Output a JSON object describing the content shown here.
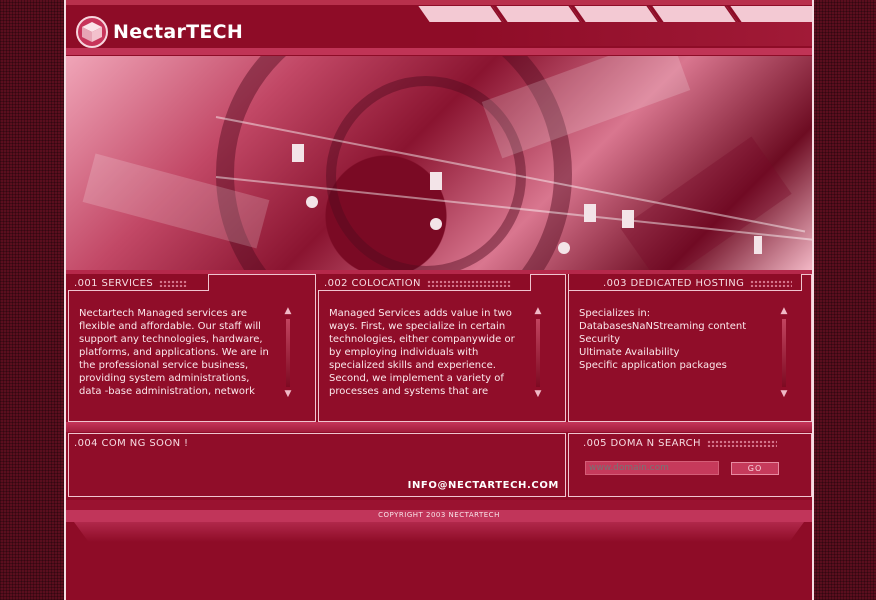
{
  "brand": {
    "name": "NectarTECH"
  },
  "colors": {
    "primary": "#8e0c27",
    "accent": "#c1355a",
    "light": "#f3c9d3",
    "text": "#fbe8ec"
  },
  "panels": [
    {
      "title": ".001 SERVICES",
      "text": "Nectartech Managed services are flexible and affordable. Our staff will support any technologies, hardware, platforms, and applications. We are in the professional service business, providing system administrations, data -base administration, network"
    },
    {
      "title": ".002 COLOCATION",
      "text": "Managed Services adds value in two ways. First, we specialize in certain technologies, either companywide or by employing individuals with specialized skills and experience. Second, we implement a variety of processes and systems that are"
    },
    {
      "title": ".003 DEDICATED HOSTING",
      "lines": [
        "Specializes in:",
        "DatabasesNaNStreaming content",
        "Security",
        "Ultimate Availability",
        "Specific application packages"
      ]
    }
  ],
  "coming_soon": {
    "title": ".004 COM NG SOON !",
    "email": "INFO@NECTARTECH.COM"
  },
  "domain_search": {
    "title": ".005 DOMA N SEARCH",
    "placeholder": "www.domain.com",
    "button": "GO"
  },
  "footer": {
    "copyright": "COPYRIGHT 2003 NECTARTECH"
  },
  "icons": {
    "logo": "cube-logo-icon",
    "scroll_up": "chevron-up-icon",
    "scroll_down": "chevron-down-icon"
  }
}
